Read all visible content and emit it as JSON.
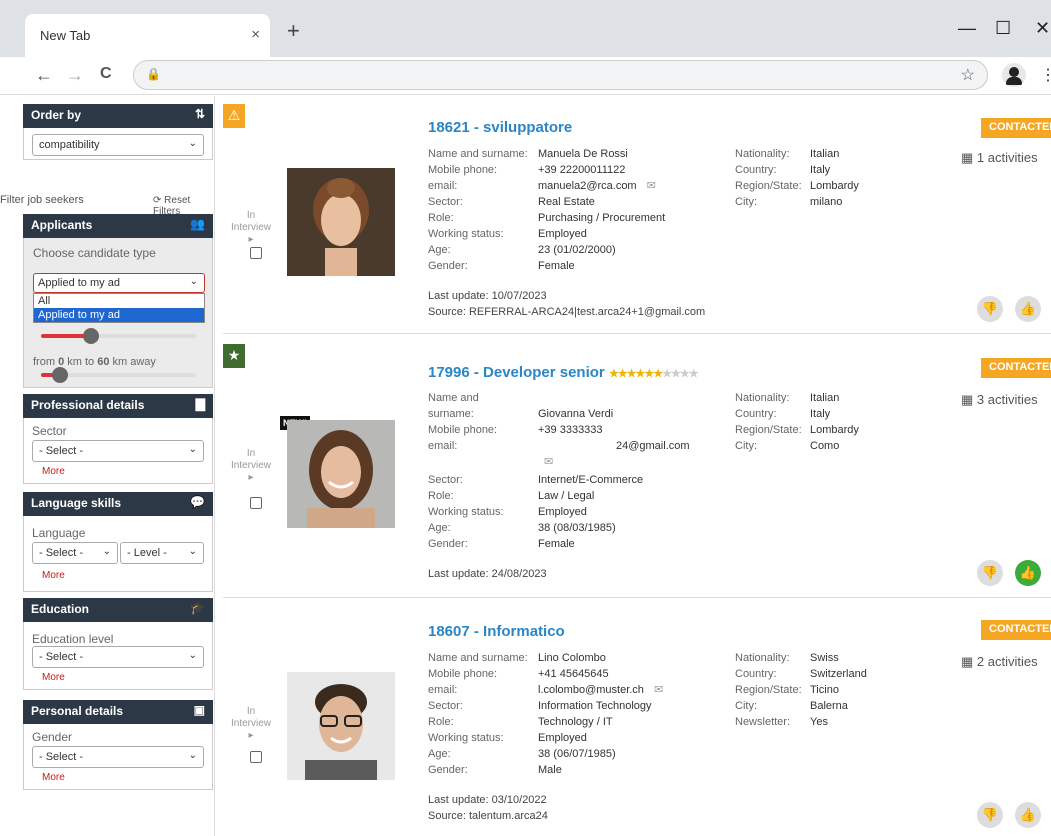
{
  "browser": {
    "tab_title": "New Tab",
    "tab_close": "×",
    "new_tab": "+",
    "minimize": "—",
    "maximize": "☐",
    "close": "✕",
    "back": "←",
    "forward": "→",
    "reload": "C",
    "lock": "🔒",
    "bookmark": "☆",
    "menu": "⋮"
  },
  "sidebar": {
    "order_by": {
      "title": "Order by",
      "value": "compatibility"
    },
    "filter_title": "Filter job seekers",
    "reset_label": "Reset Filters",
    "applicants": {
      "title": "Applicants",
      "label": "Choose candidate type",
      "value": "Applied to my ad",
      "options": [
        "All",
        "Applied to my ad"
      ],
      "distance_prefix": "from",
      "distance_from": "0",
      "distance_mid": "km to",
      "distance_to": "60",
      "distance_suffix": "km away",
      "slider1_fill": 0.32,
      "slider2_fill": 0.12
    },
    "professional": {
      "title": "Professional details",
      "label": "Sector",
      "value": "- Select -",
      "more": "More"
    },
    "language": {
      "title": "Language skills",
      "label": "Language",
      "value": "- Select -",
      "level": "- Level -",
      "more": "More"
    },
    "education": {
      "title": "Education",
      "label": "Education level",
      "value": "- Select -",
      "more": "More"
    },
    "personal": {
      "title": "Personal details",
      "label": "Gender",
      "value": "- Select -",
      "more": "More"
    }
  },
  "candidates": [
    {
      "badge": "⚠",
      "badge_color": "#f5a623",
      "interview": "In Interview",
      "title": "18621 - sviluppatore",
      "status": "CONTACTED",
      "activities": "1 activities",
      "fields": {
        "name_k": "Name and surname:",
        "name_v": "Manuela De Rossi",
        "phone_k": "Mobile phone:",
        "phone_v": "+39 22200011122",
        "email_k": "email:",
        "email_v": "manuela2@rca.com",
        "sector_k": "Sector:",
        "sector_v": "Real Estate",
        "role_k": "Role:",
        "role_v": "Purchasing / Procurement",
        "ws_k": "Working status:",
        "ws_v": "Employed",
        "age_k": "Age:",
        "age_v": "23 (01/02/2000)",
        "gender_k": "Gender:",
        "gender_v": "Female"
      },
      "right": {
        "nat_k": "Nationality:",
        "nat_v": "Italian",
        "country_k": "Country:",
        "country_v": "Italy",
        "region_k": "Region/State:",
        "region_v": "Lombardy",
        "city_k": "City:",
        "city_v": "milano"
      },
      "last_update": "Last update: 10/07/2023",
      "source": "Source: REFERRAL-ARCA24|test.arca24+1@gmail.com"
    },
    {
      "badge": "★",
      "badge_color": "#3f6b2f",
      "interview": "In Interview",
      "new_label": "NEW!",
      "title": "17996 - Developer senior",
      "stars_on": "★★★★★★",
      "stars_off": "★★★★",
      "status": "CONTACTED",
      "activities": "3 activities",
      "fields": {
        "name_k": "Name and",
        "name_k2": "surname:",
        "name_v": "Giovanna Verdi",
        "phone_k": "Mobile phone:",
        "phone_v": "+39 3333333",
        "email_k": "email:",
        "email_v": "24@gmail.com",
        "sector_k": "Sector:",
        "sector_v": "Internet/E-Commerce",
        "role_k": "Role:",
        "role_v": "Law / Legal",
        "ws_k": "Working status:",
        "ws_v": "Employed",
        "age_k": "Age:",
        "age_v": "38 (08/03/1985)",
        "gender_k": "Gender:",
        "gender_v": "Female"
      },
      "right": {
        "nat_k": "Nationality:",
        "nat_v": "Italian",
        "country_k": "Country:",
        "country_v": "Italy",
        "region_k": "Region/State:",
        "region_v": "Lombardy",
        "city_k": "City:",
        "city_v": "Como"
      },
      "last_update": "Last update: 24/08/2023"
    },
    {
      "interview": "In Interview",
      "title": "18607 - Informatico",
      "status": "CONTACTED",
      "activities": "2 activities",
      "fields": {
        "name_k": "Name and surname:",
        "name_v": "Lino Colombo",
        "phone_k": "Mobile phone:",
        "phone_v": "+41 45645645",
        "email_k": "email:",
        "email_v": "l.colombo@muster.ch",
        "sector_k": "Sector:",
        "sector_v": "Information Technology",
        "role_k": "Role:",
        "role_v": "Technology / IT",
        "ws_k": "Working status:",
        "ws_v": "Employed",
        "age_k": "Age:",
        "age_v": "38 (06/07/1985)",
        "gender_k": "Gender:",
        "gender_v": "Male"
      },
      "right": {
        "nat_k": "Nationality:",
        "nat_v": "Swiss",
        "country_k": "Country:",
        "country_v": "Switzerland",
        "region_k": "Region/State:",
        "region_v": "Ticino",
        "city_k": "City:",
        "city_v": "Balerna",
        "news_k": "Newsletter:",
        "news_v": "Yes"
      },
      "last_update": "Last update: 03/10/2022",
      "source": "Source: talentum.arca24"
    }
  ]
}
